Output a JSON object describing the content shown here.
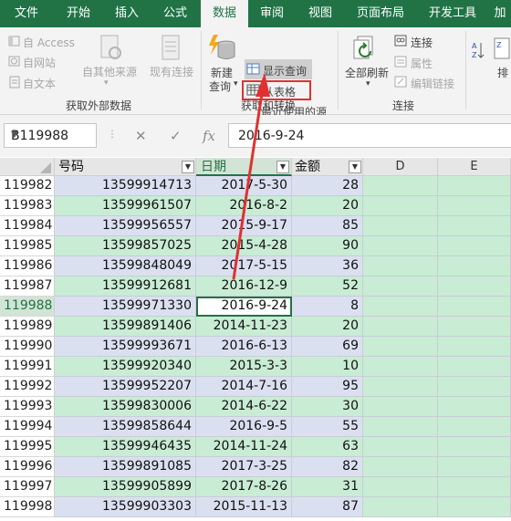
{
  "tabs": [
    "文件",
    "开始",
    "插入",
    "公式",
    "数据",
    "审阅",
    "视图",
    "页面布局",
    "开发工具",
    "加"
  ],
  "active_tab": "数据",
  "ribbon": {
    "get_external": {
      "from_access": "自 Access",
      "from_web": "自网站",
      "from_text": "自文本",
      "from_other": "自其他来源",
      "existing": "现有连接",
      "label": "获取外部数据"
    },
    "transform": {
      "new_query_line1": "新建",
      "new_query_line2": "查询",
      "show_query": "显示查询",
      "from_table": "从表格",
      "recent_sources": "最近使用的源",
      "label": "获取和转换"
    },
    "connections": {
      "refresh_all": "全部刷新",
      "connections": "连接",
      "properties": "属性",
      "edit_links": "编辑链接",
      "label": "连接"
    },
    "sort": {
      "sort_label": "排"
    }
  },
  "formula_bar": {
    "name_box": "B119988",
    "formula": "2016-9-24"
  },
  "columns": {
    "col_d": "D",
    "col_e": "E",
    "hdr_number": "号码",
    "hdr_date": "日期",
    "hdr_amount": "金额"
  },
  "rows": [
    {
      "row": "119982",
      "number": "13599914713",
      "date": "2017-5-30",
      "amount": "28"
    },
    {
      "row": "119983",
      "number": "13599961507",
      "date": "2016-8-2",
      "amount": "20"
    },
    {
      "row": "119984",
      "number": "13599956557",
      "date": "2015-9-17",
      "amount": "85"
    },
    {
      "row": "119985",
      "number": "13599857025",
      "date": "2015-4-28",
      "amount": "90"
    },
    {
      "row": "119986",
      "number": "13599848049",
      "date": "2017-5-15",
      "amount": "36"
    },
    {
      "row": "119987",
      "number": "13599912681",
      "date": "2016-12-9",
      "amount": "52"
    },
    {
      "row": "119988",
      "number": "13599971330",
      "date": "2016-9-24",
      "amount": "8"
    },
    {
      "row": "119989",
      "number": "13599891406",
      "date": "2014-11-23",
      "amount": "20"
    },
    {
      "row": "119990",
      "number": "13599993671",
      "date": "2016-6-13",
      "amount": "69"
    },
    {
      "row": "119991",
      "number": "13599920340",
      "date": "2015-3-3",
      "amount": "10"
    },
    {
      "row": "119992",
      "number": "13599952207",
      "date": "2014-7-16",
      "amount": "95"
    },
    {
      "row": "119993",
      "number": "13599830006",
      "date": "2014-6-22",
      "amount": "30"
    },
    {
      "row": "119994",
      "number": "13599858644",
      "date": "2016-9-5",
      "amount": "55"
    },
    {
      "row": "119995",
      "number": "13599946435",
      "date": "2014-11-24",
      "amount": "63"
    },
    {
      "row": "119996",
      "number": "13599891085",
      "date": "2017-3-25",
      "amount": "82"
    },
    {
      "row": "119997",
      "number": "13599905899",
      "date": "2017-8-26",
      "amount": "31"
    },
    {
      "row": "119998",
      "number": "13599903303",
      "date": "2015-11-13",
      "amount": "87"
    }
  ],
  "selected_row": "119988",
  "colors": {
    "excel_green": "#217346",
    "table_band_blue": "#dbe0f1",
    "table_band_green": "#c8ecd4",
    "annotation_red": "#e03131"
  }
}
